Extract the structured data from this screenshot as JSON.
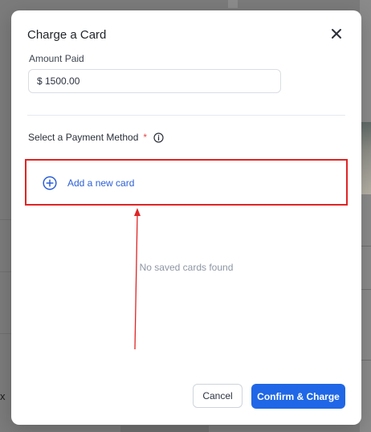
{
  "modal": {
    "title": "Charge a Card",
    "close_icon": "close-icon"
  },
  "amount": {
    "label": "Amount Paid",
    "value": "$ 1500.00"
  },
  "payment_method": {
    "label": "Select a Payment Method",
    "required_marker": "*",
    "info_icon": "info-icon"
  },
  "add_card": {
    "label": "Add a new card",
    "icon": "plus-circle-icon"
  },
  "saved_cards": {
    "empty_text": "No saved cards found"
  },
  "actions": {
    "cancel_label": "Cancel",
    "confirm_label": "Confirm & Charge"
  },
  "colors": {
    "primary": "#1f67e6",
    "link": "#2c5fd6",
    "annotation": "#e02424",
    "overlay": "#7b7b7b"
  },
  "background": {
    "close_glyph": "x"
  }
}
